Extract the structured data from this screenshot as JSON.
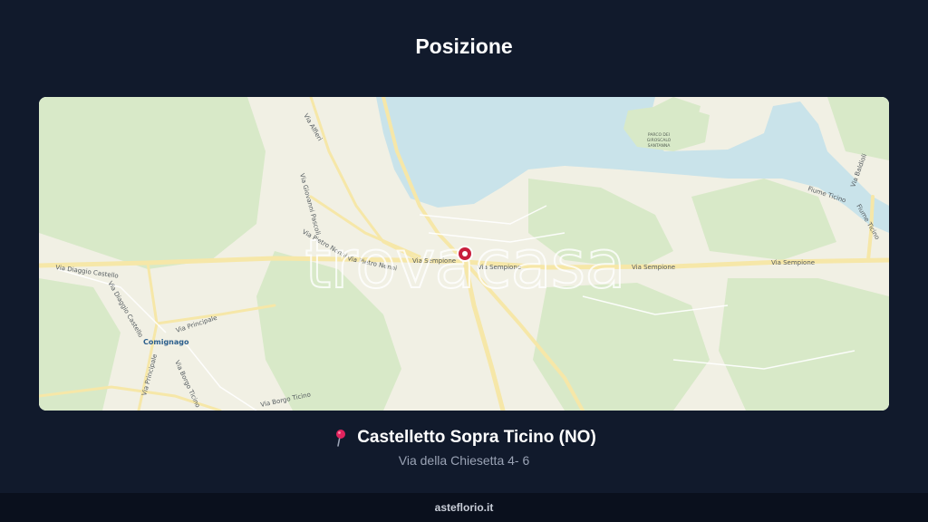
{
  "header": {
    "title": "Posizione"
  },
  "map": {
    "watermark": "trovacasa",
    "road_labels": {
      "via_sempione_1": "Via Sempione",
      "via_sempione_2": "Via Sempione",
      "via_sempione_3": "Via Sempione",
      "via_sempione_4": "Via Sempione",
      "via_pietro_nenni_1": "Via Pietro Nenni",
      "via_pietro_nenni_2": "Via Pietro Nenni",
      "via_principale": "Via Principale",
      "via_diaggio_castello_1": "Via Diaggio Castello",
      "via_diaggio_castello_2": "Via Diaggio Castello",
      "via_principale_v": "Via Principale",
      "via_borgo_ticino": "Via Borgo Ticino",
      "via_borgo_ticino_2": "Via Borgo Ticino",
      "via_giovanni": "Via Giovanni Pascoli",
      "via_alfieri": "Via Alfieri",
      "fiume_ticino": "Fiume Ticino",
      "via_baldioli": "Via Baldioli",
      "via_ticino_e": "Fiume Ticino"
    },
    "park_label": [
      "PARCO DEI",
      "GIROSCALO",
      "SANTANNA"
    ],
    "town_label": "Comignago",
    "marker": "location-marker"
  },
  "location": {
    "name": "Castelletto Sopra Ticino (NO)",
    "address": "Via della Chiesetta 4- 6",
    "pin_icon": "round-pushpin-icon",
    "pin_color": "#e0245e"
  },
  "footer": {
    "brand": "asteflorio.it"
  },
  "colors": {
    "background": "#111a2c",
    "water": "#c9e3ea",
    "land": "#f1f0e4",
    "green": "#d8e9c8",
    "road": "#f6e7a8"
  }
}
